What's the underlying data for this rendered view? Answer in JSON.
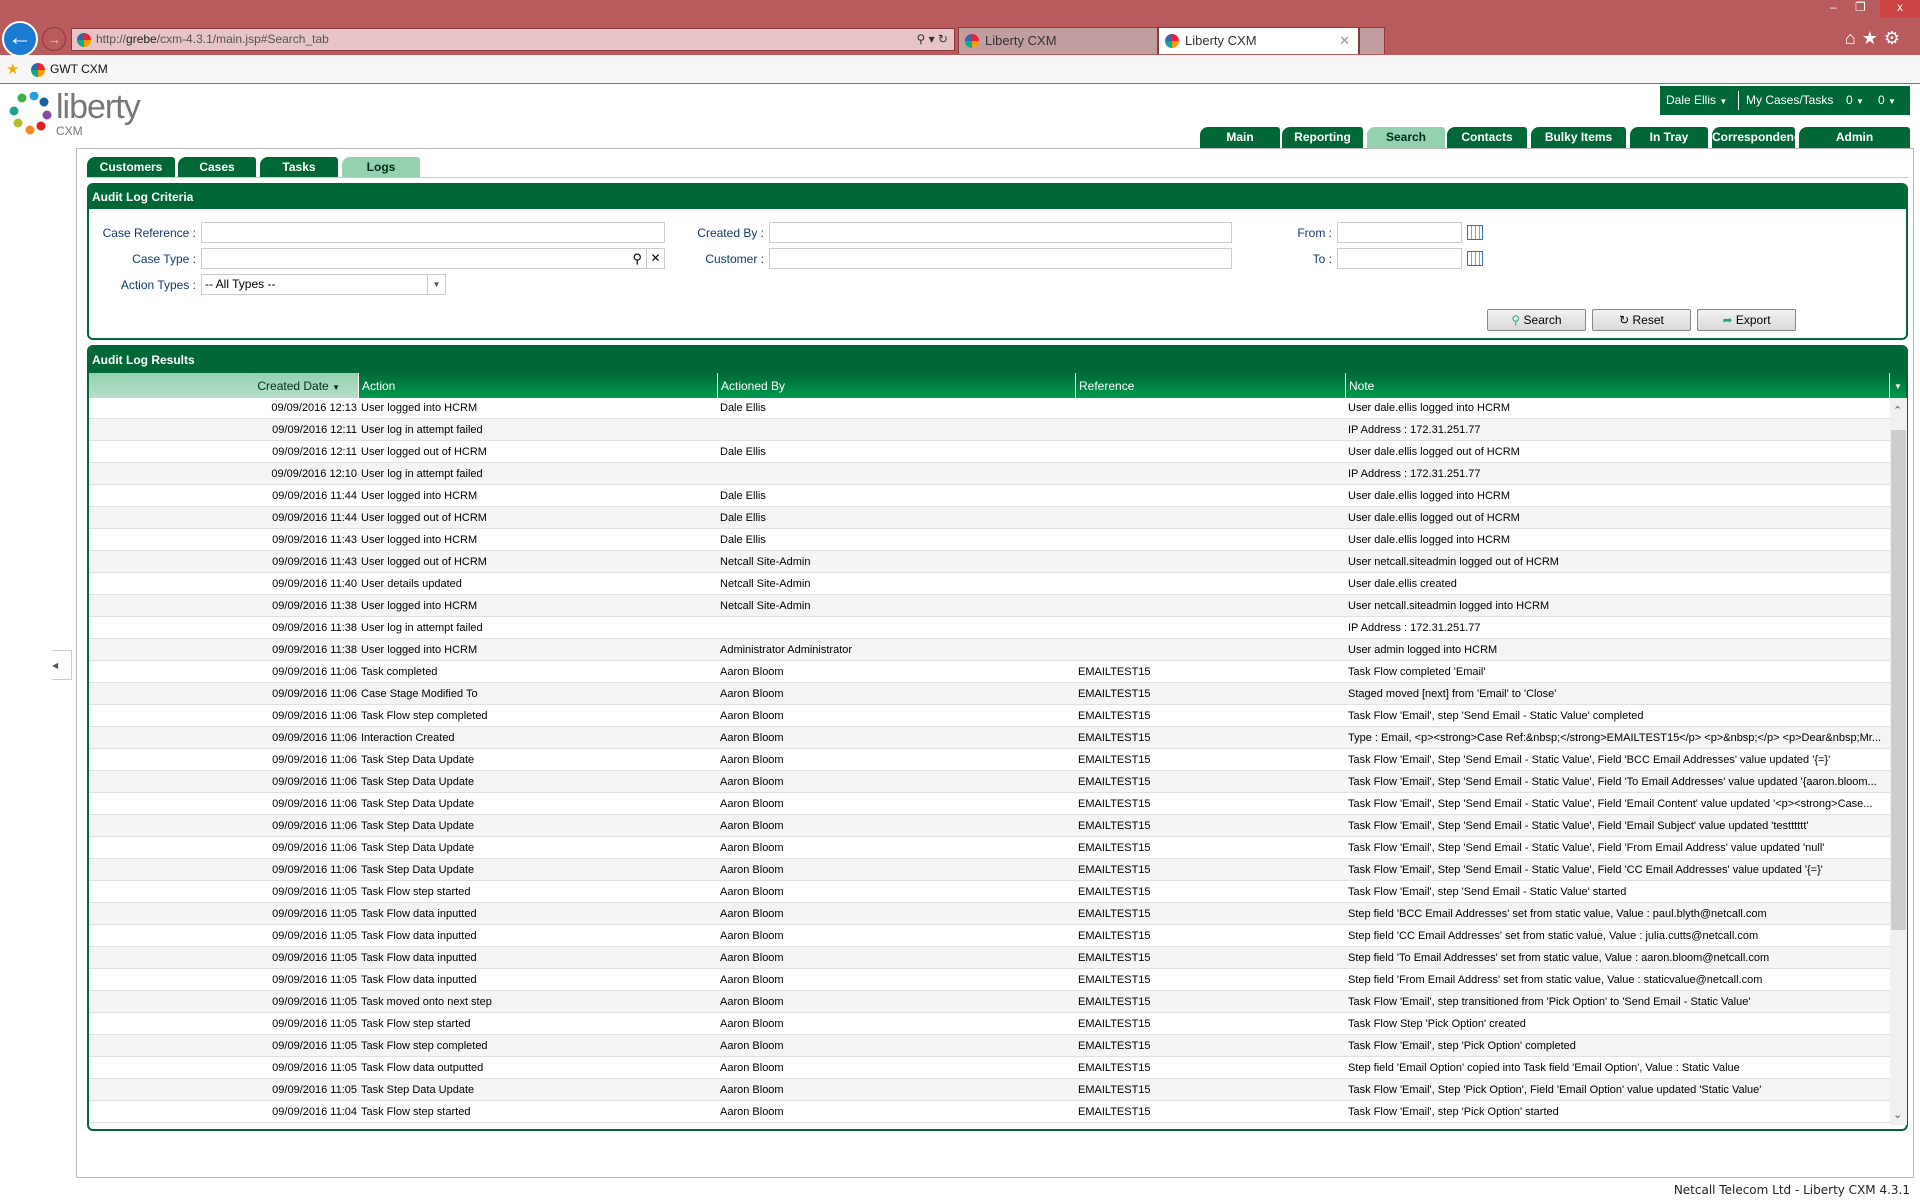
{
  "browser": {
    "url_prefix": "http://",
    "url_host": "grebe",
    "url_path": "/cxm-4.3.1/main.jsp#Search_tab",
    "tabs": [
      {
        "label": "Liberty CXM"
      },
      {
        "label": "Liberty CXM"
      }
    ],
    "favorite": "GWT CXM"
  },
  "app": {
    "logo_text": "liberty",
    "logo_sub": "CXM",
    "user": "Dale Ellis",
    "my_cases_label": "My Cases/Tasks",
    "count1": "0",
    "count2": "0"
  },
  "main_tabs": [
    {
      "label": "Main"
    },
    {
      "label": "Reporting"
    },
    {
      "label": "Search",
      "active": true
    },
    {
      "label": "Contacts"
    },
    {
      "label": "Bulky Items"
    },
    {
      "label": "In Tray"
    },
    {
      "label": "Correspondence"
    },
    {
      "label": "Admin"
    }
  ],
  "sub_tabs": [
    {
      "label": "Customers"
    },
    {
      "label": "Cases"
    },
    {
      "label": "Tasks"
    },
    {
      "label": "Logs",
      "active": true
    }
  ],
  "criteria": {
    "title": "Audit Log Criteria",
    "case_reference_label": "Case Reference :",
    "case_type_label": "Case Type :",
    "action_types_label": "Action Types :",
    "action_types_value": "-- All Types --",
    "created_by_label": "Created By :",
    "customer_label": "Customer :",
    "from_label": "From :",
    "to_label": "To :",
    "search_label": "Search",
    "reset_label": "Reset",
    "export_label": "Export"
  },
  "results": {
    "title": "Audit Log Results",
    "columns": [
      "Created Date",
      "Action",
      "Actioned By",
      "Reference",
      "Note"
    ],
    "rows": [
      [
        "09/09/2016 12:13",
        "User logged into HCRM",
        "Dale Ellis",
        "",
        "User dale.ellis logged into HCRM"
      ],
      [
        "09/09/2016 12:11",
        "User log in attempt failed",
        "",
        "",
        "IP Address : 172.31.251.77"
      ],
      [
        "09/09/2016 12:11",
        "User logged out of HCRM",
        "Dale Ellis",
        "",
        "User dale.ellis logged out of HCRM"
      ],
      [
        "09/09/2016 12:10",
        "User log in attempt failed",
        "",
        "",
        "IP Address : 172.31.251.77"
      ],
      [
        "09/09/2016 11:44",
        "User logged into HCRM",
        "Dale Ellis",
        "",
        "User dale.ellis logged into HCRM"
      ],
      [
        "09/09/2016 11:44",
        "User logged out of HCRM",
        "Dale Ellis",
        "",
        "User dale.ellis logged out of HCRM"
      ],
      [
        "09/09/2016 11:43",
        "User logged into HCRM",
        "Dale Ellis",
        "",
        "User dale.ellis logged into HCRM"
      ],
      [
        "09/09/2016 11:43",
        "User logged out of HCRM",
        "Netcall Site-Admin",
        "",
        "User netcall.siteadmin logged out of HCRM"
      ],
      [
        "09/09/2016 11:40",
        "User details updated",
        "Netcall Site-Admin",
        "",
        "User dale.ellis created"
      ],
      [
        "09/09/2016 11:38",
        "User logged into HCRM",
        "Netcall Site-Admin",
        "",
        "User netcall.siteadmin logged into HCRM"
      ],
      [
        "09/09/2016 11:38",
        "User log in attempt failed",
        "",
        "",
        "IP Address : 172.31.251.77"
      ],
      [
        "09/09/2016 11:38",
        "User logged into HCRM",
        "Administrator Administrator",
        "",
        "User admin logged into HCRM"
      ],
      [
        "09/09/2016 11:06",
        "Task completed",
        "Aaron Bloom",
        "EMAILTEST15",
        "Task Flow completed 'Email'"
      ],
      [
        "09/09/2016 11:06",
        "Case Stage Modified To",
        "Aaron Bloom",
        "EMAILTEST15",
        "Staged moved [next] from 'Email' to 'Close'"
      ],
      [
        "09/09/2016 11:06",
        "Task Flow step completed",
        "Aaron Bloom",
        "EMAILTEST15",
        "Task Flow 'Email', step 'Send Email - Static Value' completed"
      ],
      [
        "09/09/2016 11:06",
        "Interaction Created",
        "Aaron Bloom",
        "EMAILTEST15",
        "Type : Email, <p><strong>Case Ref:&nbsp;</strong>EMAILTEST15</p> <p>&nbsp;</p> <p>Dear&nbsp;Mr..."
      ],
      [
        "09/09/2016 11:06",
        "Task Step Data Update",
        "Aaron Bloom",
        "EMAILTEST15",
        "Task Flow 'Email', Step 'Send Email - Static Value', Field 'BCC Email Addresses' value updated '{=}'"
      ],
      [
        "09/09/2016 11:06",
        "Task Step Data Update",
        "Aaron Bloom",
        "EMAILTEST15",
        "Task Flow 'Email', Step 'Send Email - Static Value', Field 'To Email Addresses' value updated '{aaron.bloom..."
      ],
      [
        "09/09/2016 11:06",
        "Task Step Data Update",
        "Aaron Bloom",
        "EMAILTEST15",
        "Task Flow 'Email', Step 'Send Email - Static Value', Field 'Email Content' value updated '<p><strong>Case..."
      ],
      [
        "09/09/2016 11:06",
        "Task Step Data Update",
        "Aaron Bloom",
        "EMAILTEST15",
        "Task Flow 'Email', Step 'Send Email - Static Value', Field 'Email Subject' value updated 'testttttt'"
      ],
      [
        "09/09/2016 11:06",
        "Task Step Data Update",
        "Aaron Bloom",
        "EMAILTEST15",
        "Task Flow 'Email', Step 'Send Email - Static Value', Field 'From Email Address' value updated 'null'"
      ],
      [
        "09/09/2016 11:06",
        "Task Step Data Update",
        "Aaron Bloom",
        "EMAILTEST15",
        "Task Flow 'Email', Step 'Send Email - Static Value', Field 'CC Email Addresses' value updated '{=}'"
      ],
      [
        "09/09/2016 11:05",
        "Task Flow step started",
        "Aaron Bloom",
        "EMAILTEST15",
        "Task Flow 'Email', step 'Send Email - Static Value' started"
      ],
      [
        "09/09/2016 11:05",
        "Task Flow data inputted",
        "Aaron Bloom",
        "EMAILTEST15",
        "Step field 'BCC Email Addresses' set from static value, Value : paul.blyth@netcall.com"
      ],
      [
        "09/09/2016 11:05",
        "Task Flow data inputted",
        "Aaron Bloom",
        "EMAILTEST15",
        "Step field 'CC Email Addresses' set from static value, Value : julia.cutts@netcall.com"
      ],
      [
        "09/09/2016 11:05",
        "Task Flow data inputted",
        "Aaron Bloom",
        "EMAILTEST15",
        "Step field 'To Email Addresses' set from static value, Value : aaron.bloom@netcall.com"
      ],
      [
        "09/09/2016 11:05",
        "Task Flow data inputted",
        "Aaron Bloom",
        "EMAILTEST15",
        "Step field 'From Email Address' set from static value, Value : staticvalue@netcall.com"
      ],
      [
        "09/09/2016 11:05",
        "Task moved onto next step",
        "Aaron Bloom",
        "EMAILTEST15",
        "Task Flow 'Email', step transitioned from 'Pick Option' to 'Send Email - Static Value'"
      ],
      [
        "09/09/2016 11:05",
        "Task Flow step started",
        "Aaron Bloom",
        "EMAILTEST15",
        "Task Flow Step 'Pick Option' created"
      ],
      [
        "09/09/2016 11:05",
        "Task Flow step completed",
        "Aaron Bloom",
        "EMAILTEST15",
        "Task Flow 'Email', step 'Pick Option' completed"
      ],
      [
        "09/09/2016 11:05",
        "Task Flow data outputted",
        "Aaron Bloom",
        "EMAILTEST15",
        "Step field 'Email Option' copied into Task field 'Email Option', Value : Static Value"
      ],
      [
        "09/09/2016 11:05",
        "Task Step Data Update",
        "Aaron Bloom",
        "EMAILTEST15",
        "Task Flow 'Email', Step 'Pick Option', Field 'Email Option' value updated 'Static Value'"
      ],
      [
        "09/09/2016 11:04",
        "Task Flow step started",
        "Aaron Bloom",
        "EMAILTEST15",
        "Task Flow 'Email', step 'Pick Option' started"
      ]
    ]
  },
  "footer": "Netcall Telecom Ltd - Liberty CXM 4.3.1",
  "colors": {
    "brand_green": "#006837",
    "active_tab": "#93d1b0",
    "browser_chrome": "#b95a5c"
  }
}
